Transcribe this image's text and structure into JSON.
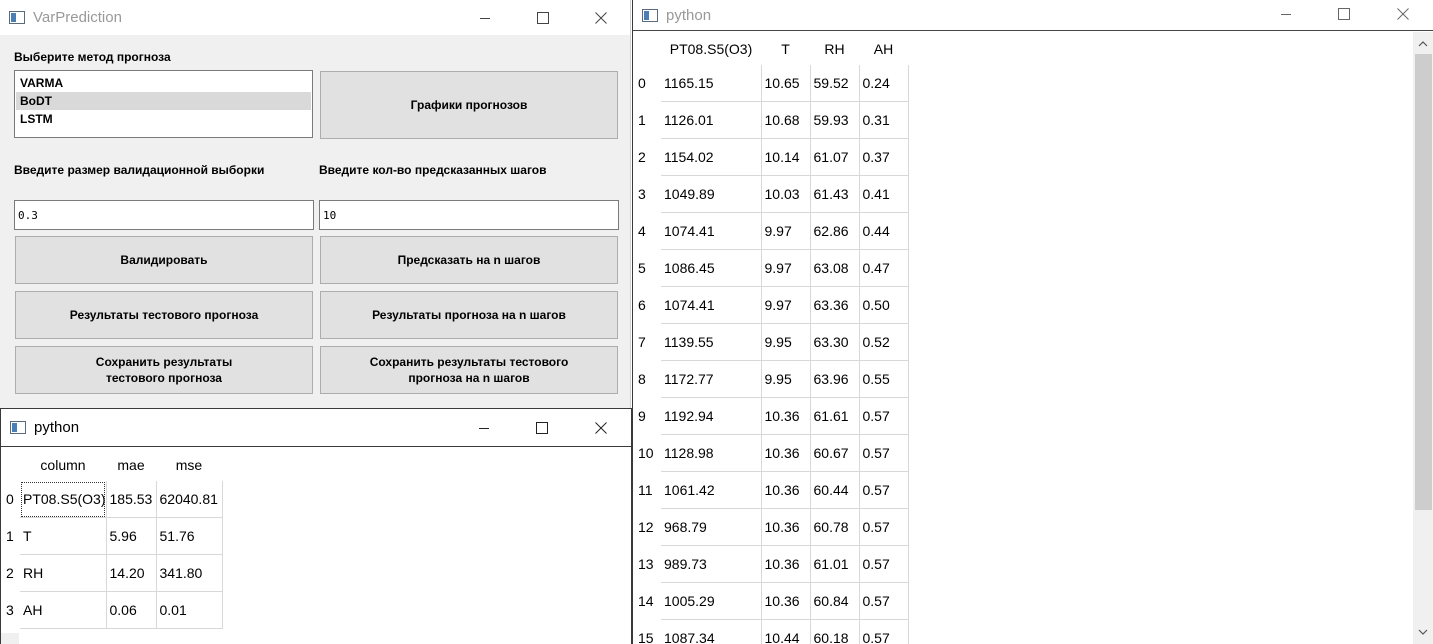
{
  "var_window": {
    "title": "VarPrediction",
    "method_label": "Выберите метод прогноза",
    "methods": [
      "VARMA",
      "BoDT",
      "LSTM"
    ],
    "selected_method": "BoDT",
    "plots_button": "Графики прогнозов",
    "validation_size_label": "Введите размер валидационной выборки",
    "steps_label": "Введите кол-во предсказанных шагов",
    "validation_size_value": "0.3",
    "steps_value": "10",
    "validate_button": "Валидировать",
    "predict_button": "Предсказать на n шагов",
    "test_results_button": "Результаты тестового прогноза",
    "n_results_button": "Результаты прогноза на n шагов",
    "save_test_button": "Сохранить результаты\nтестового прогноза",
    "save_n_button": "Сохранить результаты тестового\nпрогноза на n шагов"
  },
  "metrics_window": {
    "title": "python",
    "columns": [
      "column",
      "mae",
      "mse"
    ],
    "rows": [
      {
        "idx": "0",
        "cells": [
          "PT08.S5(O3)",
          "185.53",
          "62040.81"
        ]
      },
      {
        "idx": "1",
        "cells": [
          "T",
          "5.96",
          "51.76"
        ]
      },
      {
        "idx": "2",
        "cells": [
          "RH",
          "14.20",
          "341.80"
        ]
      },
      {
        "idx": "3",
        "cells": [
          "AH",
          "0.06",
          "0.01"
        ]
      }
    ]
  },
  "forecast_window": {
    "title": "python",
    "columns": [
      "PT08.S5(O3)",
      "T",
      "RH",
      "AH"
    ],
    "rows": [
      {
        "idx": "0",
        "cells": [
          "1165.15",
          "10.65",
          "59.52",
          "0.24"
        ]
      },
      {
        "idx": "1",
        "cells": [
          "1126.01",
          "10.68",
          "59.93",
          "0.31"
        ]
      },
      {
        "idx": "2",
        "cells": [
          "1154.02",
          "10.14",
          "61.07",
          "0.37"
        ]
      },
      {
        "idx": "3",
        "cells": [
          "1049.89",
          "10.03",
          "61.43",
          "0.41"
        ]
      },
      {
        "idx": "4",
        "cells": [
          "1074.41",
          "9.97",
          "62.86",
          "0.44"
        ]
      },
      {
        "idx": "5",
        "cells": [
          "1086.45",
          "9.97",
          "63.08",
          "0.47"
        ]
      },
      {
        "idx": "6",
        "cells": [
          "1074.41",
          "9.97",
          "63.36",
          "0.50"
        ]
      },
      {
        "idx": "7",
        "cells": [
          "1139.55",
          "9.95",
          "63.30",
          "0.52"
        ]
      },
      {
        "idx": "8",
        "cells": [
          "1172.77",
          "9.95",
          "63.96",
          "0.55"
        ]
      },
      {
        "idx": "9",
        "cells": [
          "1192.94",
          "10.36",
          "61.61",
          "0.57"
        ]
      },
      {
        "idx": "10",
        "cells": [
          "1128.98",
          "10.36",
          "60.67",
          "0.57"
        ]
      },
      {
        "idx": "11",
        "cells": [
          "1061.42",
          "10.36",
          "60.44",
          "0.57"
        ]
      },
      {
        "idx": "12",
        "cells": [
          "968.79",
          "10.36",
          "60.78",
          "0.57"
        ]
      },
      {
        "idx": "13",
        "cells": [
          "989.73",
          "10.36",
          "61.01",
          "0.57"
        ]
      },
      {
        "idx": "14",
        "cells": [
          "1005.29",
          "10.36",
          "60.84",
          "0.57"
        ]
      },
      {
        "idx": "15",
        "cells": [
          "1087.34",
          "10.44",
          "60.18",
          "0.57"
        ]
      }
    ]
  }
}
